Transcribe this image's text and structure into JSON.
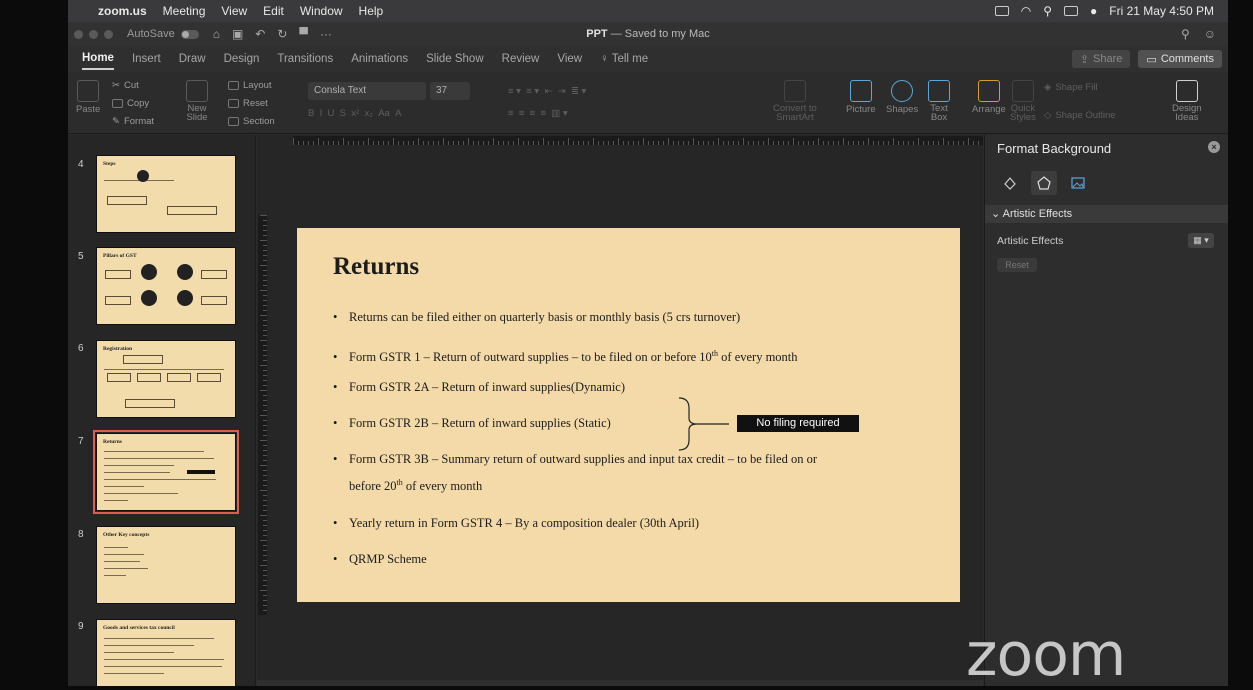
{
  "menubar": {
    "app": "zoom.us",
    "items": [
      "Meeting",
      "View",
      "Edit",
      "Window",
      "Help"
    ],
    "datetime": "Fri 21 May  4:50 PM"
  },
  "titlebar": {
    "autosave_label": "AutoSave",
    "autosave_state": "off",
    "doc_name": "PPT",
    "doc_status": " — Saved to my Mac"
  },
  "tabs": {
    "items": [
      "Home",
      "Insert",
      "Draw",
      "Design",
      "Transitions",
      "Animations",
      "Slide Show",
      "Review",
      "View"
    ],
    "active": "Home",
    "tell_me": "Tell me",
    "share": "Share",
    "comments": "Comments"
  },
  "ribbon": {
    "paste": "Paste",
    "cut": "Cut",
    "copy": "Copy",
    "format": "Format",
    "new_slide": "New\nSlide",
    "layout": "Layout",
    "reset": "Reset",
    "section": "Section",
    "font_name": "Consla Text",
    "font_size": "37",
    "convert": "Convert to\nSmartArt",
    "picture": "Picture",
    "shapes": "Shapes",
    "text_box": "Text\nBox",
    "arrange": "Arrange",
    "quick_styles": "Quick\nStyles",
    "shape_fill": "Shape Fill",
    "shape_outline": "Shape Outline",
    "design_ideas": "Design\nIdeas"
  },
  "thumbnails": [
    {
      "num": "4",
      "title": "Steps",
      "selected": false
    },
    {
      "num": "5",
      "title": "Pillars of GST",
      "selected": false
    },
    {
      "num": "6",
      "title": "Registration",
      "selected": false
    },
    {
      "num": "7",
      "title": "Returns",
      "selected": true
    },
    {
      "num": "8",
      "title": "Other Key concepts",
      "selected": false
    },
    {
      "num": "9",
      "title": "Goods and services tax council",
      "selected": false
    }
  ],
  "slide": {
    "title": "Returns",
    "bullets": [
      {
        "pre": "Returns can be filed either on quarterly basis or monthly basis (5 crs turnover)"
      },
      {
        "pre": "Form GSTR 1 – Return of outward supplies – to be filed on or before 10",
        "sup": "th",
        "post": " of every month"
      },
      {
        "pre": "Form GSTR 2A – Return of inward supplies(Dynamic)"
      },
      {
        "pre": "Form GSTR 2B – Return of inward supplies (Static)"
      },
      {
        "pre": "Form GSTR 3B – Summary return of outward supplies and input tax credit – to be filed on or"
      },
      {
        "pre": "Yearly return in Form GSTR 4 – By a composition dealer (30th April)"
      },
      {
        "pre": "QRMP Scheme"
      }
    ],
    "gstr3b_cont_pre": "before 20",
    "gstr3b_cont_sup": "th",
    "gstr3b_cont_post": " of every month",
    "callout": "No filing required"
  },
  "format_pane": {
    "title": "Format Background",
    "section": "Artistic Effects",
    "label": "Artistic Effects",
    "reset": "Reset"
  },
  "overlay": {
    "logo": "zoom"
  }
}
